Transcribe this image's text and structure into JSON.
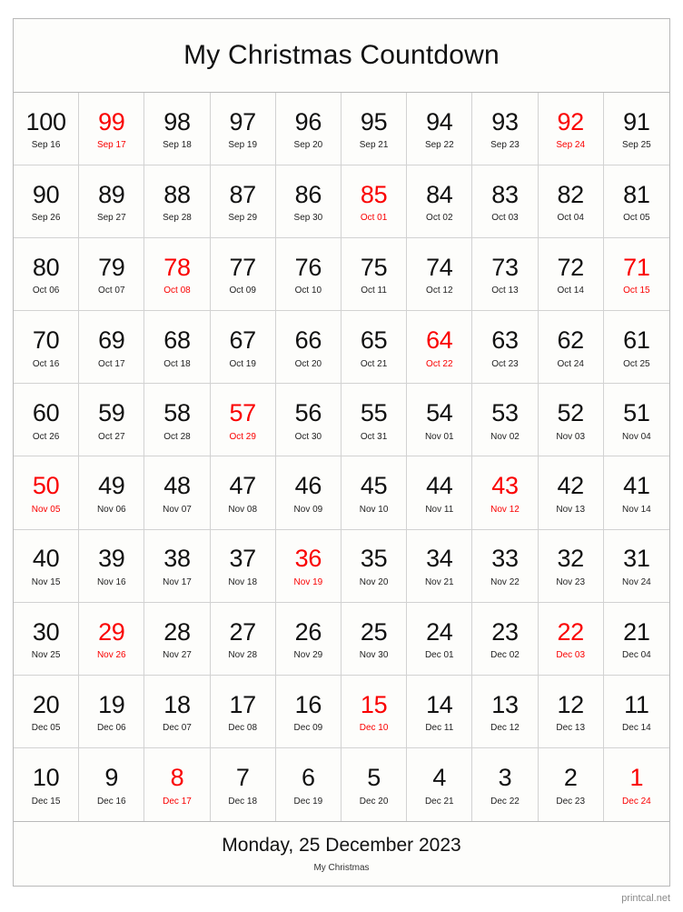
{
  "page": {
    "title": "My Christmas Countdown",
    "watermark": "printcal.net",
    "accent_color": "#fa0000",
    "text_color": "#111111",
    "border_color": "#d2d2d2",
    "background_color": "#fdfdfb"
  },
  "footer": {
    "target_date": "Monday, 25 December 2023",
    "subtitle": "My Christmas"
  },
  "grid": {
    "columns": 10,
    "rows": 10,
    "start_count": 100,
    "end_count": 1,
    "start_date": "Sep 16",
    "end_date": "Dec 24",
    "highlight_meaning": "Sunday"
  },
  "cells": [
    {
      "count": "100",
      "date": "Sep 16",
      "highlight": false
    },
    {
      "count": "99",
      "date": "Sep 17",
      "highlight": true
    },
    {
      "count": "98",
      "date": "Sep 18",
      "highlight": false
    },
    {
      "count": "97",
      "date": "Sep 19",
      "highlight": false
    },
    {
      "count": "96",
      "date": "Sep 20",
      "highlight": false
    },
    {
      "count": "95",
      "date": "Sep 21",
      "highlight": false
    },
    {
      "count": "94",
      "date": "Sep 22",
      "highlight": false
    },
    {
      "count": "93",
      "date": "Sep 23",
      "highlight": false
    },
    {
      "count": "92",
      "date": "Sep 24",
      "highlight": true
    },
    {
      "count": "91",
      "date": "Sep 25",
      "highlight": false
    },
    {
      "count": "90",
      "date": "Sep 26",
      "highlight": false
    },
    {
      "count": "89",
      "date": "Sep 27",
      "highlight": false
    },
    {
      "count": "88",
      "date": "Sep 28",
      "highlight": false
    },
    {
      "count": "87",
      "date": "Sep 29",
      "highlight": false
    },
    {
      "count": "86",
      "date": "Sep 30",
      "highlight": false
    },
    {
      "count": "85",
      "date": "Oct 01",
      "highlight": true
    },
    {
      "count": "84",
      "date": "Oct 02",
      "highlight": false
    },
    {
      "count": "83",
      "date": "Oct 03",
      "highlight": false
    },
    {
      "count": "82",
      "date": "Oct 04",
      "highlight": false
    },
    {
      "count": "81",
      "date": "Oct 05",
      "highlight": false
    },
    {
      "count": "80",
      "date": "Oct 06",
      "highlight": false
    },
    {
      "count": "79",
      "date": "Oct 07",
      "highlight": false
    },
    {
      "count": "78",
      "date": "Oct 08",
      "highlight": true
    },
    {
      "count": "77",
      "date": "Oct 09",
      "highlight": false
    },
    {
      "count": "76",
      "date": "Oct 10",
      "highlight": false
    },
    {
      "count": "75",
      "date": "Oct 11",
      "highlight": false
    },
    {
      "count": "74",
      "date": "Oct 12",
      "highlight": false
    },
    {
      "count": "73",
      "date": "Oct 13",
      "highlight": false
    },
    {
      "count": "72",
      "date": "Oct 14",
      "highlight": false
    },
    {
      "count": "71",
      "date": "Oct 15",
      "highlight": true
    },
    {
      "count": "70",
      "date": "Oct 16",
      "highlight": false
    },
    {
      "count": "69",
      "date": "Oct 17",
      "highlight": false
    },
    {
      "count": "68",
      "date": "Oct 18",
      "highlight": false
    },
    {
      "count": "67",
      "date": "Oct 19",
      "highlight": false
    },
    {
      "count": "66",
      "date": "Oct 20",
      "highlight": false
    },
    {
      "count": "65",
      "date": "Oct 21",
      "highlight": false
    },
    {
      "count": "64",
      "date": "Oct 22",
      "highlight": true
    },
    {
      "count": "63",
      "date": "Oct 23",
      "highlight": false
    },
    {
      "count": "62",
      "date": "Oct 24",
      "highlight": false
    },
    {
      "count": "61",
      "date": "Oct 25",
      "highlight": false
    },
    {
      "count": "60",
      "date": "Oct 26",
      "highlight": false
    },
    {
      "count": "59",
      "date": "Oct 27",
      "highlight": false
    },
    {
      "count": "58",
      "date": "Oct 28",
      "highlight": false
    },
    {
      "count": "57",
      "date": "Oct 29",
      "highlight": true
    },
    {
      "count": "56",
      "date": "Oct 30",
      "highlight": false
    },
    {
      "count": "55",
      "date": "Oct 31",
      "highlight": false
    },
    {
      "count": "54",
      "date": "Nov 01",
      "highlight": false
    },
    {
      "count": "53",
      "date": "Nov 02",
      "highlight": false
    },
    {
      "count": "52",
      "date": "Nov 03",
      "highlight": false
    },
    {
      "count": "51",
      "date": "Nov 04",
      "highlight": false
    },
    {
      "count": "50",
      "date": "Nov 05",
      "highlight": true
    },
    {
      "count": "49",
      "date": "Nov 06",
      "highlight": false
    },
    {
      "count": "48",
      "date": "Nov 07",
      "highlight": false
    },
    {
      "count": "47",
      "date": "Nov 08",
      "highlight": false
    },
    {
      "count": "46",
      "date": "Nov 09",
      "highlight": false
    },
    {
      "count": "45",
      "date": "Nov 10",
      "highlight": false
    },
    {
      "count": "44",
      "date": "Nov 11",
      "highlight": false
    },
    {
      "count": "43",
      "date": "Nov 12",
      "highlight": true
    },
    {
      "count": "42",
      "date": "Nov 13",
      "highlight": false
    },
    {
      "count": "41",
      "date": "Nov 14",
      "highlight": false
    },
    {
      "count": "40",
      "date": "Nov 15",
      "highlight": false
    },
    {
      "count": "39",
      "date": "Nov 16",
      "highlight": false
    },
    {
      "count": "38",
      "date": "Nov 17",
      "highlight": false
    },
    {
      "count": "37",
      "date": "Nov 18",
      "highlight": false
    },
    {
      "count": "36",
      "date": "Nov 19",
      "highlight": true
    },
    {
      "count": "35",
      "date": "Nov 20",
      "highlight": false
    },
    {
      "count": "34",
      "date": "Nov 21",
      "highlight": false
    },
    {
      "count": "33",
      "date": "Nov 22",
      "highlight": false
    },
    {
      "count": "32",
      "date": "Nov 23",
      "highlight": false
    },
    {
      "count": "31",
      "date": "Nov 24",
      "highlight": false
    },
    {
      "count": "30",
      "date": "Nov 25",
      "highlight": false
    },
    {
      "count": "29",
      "date": "Nov 26",
      "highlight": true
    },
    {
      "count": "28",
      "date": "Nov 27",
      "highlight": false
    },
    {
      "count": "27",
      "date": "Nov 28",
      "highlight": false
    },
    {
      "count": "26",
      "date": "Nov 29",
      "highlight": false
    },
    {
      "count": "25",
      "date": "Nov 30",
      "highlight": false
    },
    {
      "count": "24",
      "date": "Dec 01",
      "highlight": false
    },
    {
      "count": "23",
      "date": "Dec 02",
      "highlight": false
    },
    {
      "count": "22",
      "date": "Dec 03",
      "highlight": true
    },
    {
      "count": "21",
      "date": "Dec 04",
      "highlight": false
    },
    {
      "count": "20",
      "date": "Dec 05",
      "highlight": false
    },
    {
      "count": "19",
      "date": "Dec 06",
      "highlight": false
    },
    {
      "count": "18",
      "date": "Dec 07",
      "highlight": false
    },
    {
      "count": "17",
      "date": "Dec 08",
      "highlight": false
    },
    {
      "count": "16",
      "date": "Dec 09",
      "highlight": false
    },
    {
      "count": "15",
      "date": "Dec 10",
      "highlight": true
    },
    {
      "count": "14",
      "date": "Dec 11",
      "highlight": false
    },
    {
      "count": "13",
      "date": "Dec 12",
      "highlight": false
    },
    {
      "count": "12",
      "date": "Dec 13",
      "highlight": false
    },
    {
      "count": "11",
      "date": "Dec 14",
      "highlight": false
    },
    {
      "count": "10",
      "date": "Dec 15",
      "highlight": false
    },
    {
      "count": "9",
      "date": "Dec 16",
      "highlight": false
    },
    {
      "count": "8",
      "date": "Dec 17",
      "highlight": true
    },
    {
      "count": "7",
      "date": "Dec 18",
      "highlight": false
    },
    {
      "count": "6",
      "date": "Dec 19",
      "highlight": false
    },
    {
      "count": "5",
      "date": "Dec 20",
      "highlight": false
    },
    {
      "count": "4",
      "date": "Dec 21",
      "highlight": false
    },
    {
      "count": "3",
      "date": "Dec 22",
      "highlight": false
    },
    {
      "count": "2",
      "date": "Dec 23",
      "highlight": false
    },
    {
      "count": "1",
      "date": "Dec 24",
      "highlight": true
    }
  ]
}
